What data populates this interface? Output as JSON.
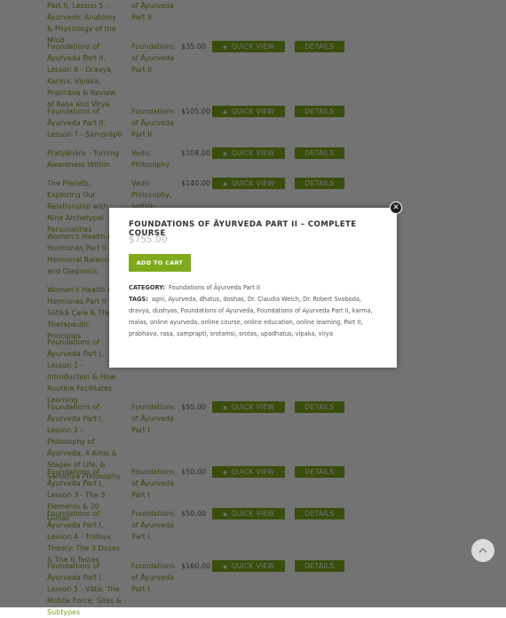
{
  "buttons": {
    "quick_view": "QUICK VIEW",
    "details": "DETAILS"
  },
  "rows": [
    {
      "title": "Part II, Lesson 5 - Āyurvedic Anatomy & Physiology of the Mind",
      "category": "of Āyurveda Part II",
      "price": "",
      "buttons": false
    },
    {
      "title": "Foundations of Āyurveda Part II, Lesson 6 - Dravya, Karma, Vipāka, Prabhāva & Review of Rasa and Vīrya",
      "category": "Foundations of Āyurveda Part II",
      "price": "$35.00",
      "buttons": true
    },
    {
      "title": "Foundations of Āyurveda Part II, Lesson 7 - Samprāpti",
      "category": "Foundations of Āyurveda Part II",
      "price": "$105.00",
      "buttons": true
    },
    {
      "title": "Pratyāhāra - Turning Awareness Within",
      "category": "Vedic Philosophy",
      "price": "$108.00",
      "buttons": true
    },
    {
      "title": "The Planets: Exploring Our Relationship with Nine Archetypal Personalities",
      "category": "Vedic Philosophy, Jyotish",
      "price": "$140.00",
      "buttons": true
    },
    {
      "title": "Women's Health & Hormones Part II - Hormonal Balance and Diagnosis",
      "category": "",
      "price": "",
      "buttons": false
    },
    {
      "title": "Women's Health & Hormones Part II - Sūtikā Care & The 3 Therapeutic Principles",
      "category": "",
      "price": "",
      "buttons": false
    },
    {
      "title": "Foundations of Āyurveda Part I, Lesson 1 - Introduction & How Routine Facilitates Learning",
      "category": "",
      "price": "",
      "buttons": false
    },
    {
      "title": "Foundations of Āyurveda Part I, Lesson 2 - Philosophy of Āyurveda, 4 Aims & Stages of Life, & Sāṁkhya Philosophy",
      "category": "Foundations of Āyurveda Part I",
      "price": "$95.00",
      "buttons": true
    },
    {
      "title": "Foundations of Āyurveda Part I, Lesson 3 - The 5 Elements & 20 Guṇas",
      "category": "Foundations of Āyurveda Part I",
      "price": "$50.00",
      "buttons": true
    },
    {
      "title": "Foundations of Āyurveda Part I, Lesson 4 - Tridoṣa Theory: The 3 Doṣas & The 6 Tastes",
      "category": "Foundations of Āyurveda Part I",
      "price": "$50.00",
      "buttons": true
    },
    {
      "title": "Foundations of Āyurveda Part I, Lesson 5 - Vāta: The Mobile Force; Sites & Subtypes",
      "category": "Foundations of Āyurveda Part I",
      "price": "$160.00",
      "buttons": true
    }
  ],
  "modal": {
    "title": "FOUNDATIONS OF ĀYURVEDA PART II – COMPLETE COURSE",
    "price": "$755.00",
    "add_to_cart": "ADD TO CART",
    "category_label": "CATEGORY:",
    "category_value": "Foundations of Āyurveda Part II",
    "tags_label": "TAGS:",
    "tags": [
      "agni",
      "Ayurveda",
      "dhatus",
      "doshas",
      "Dr. Claudia Welch",
      "Dr. Robert Svoboda",
      "dravya",
      "dushyas",
      "Foundations of Ayurveda",
      "Foundations of Ayurveda Part II",
      "karma",
      "malas",
      "online ayurveda",
      "online course",
      "online education",
      "online learning",
      "Part II",
      "prabhava",
      "rasa",
      "samprapti",
      "srotamsi",
      "srotas",
      "upadhatus",
      "vipaka",
      "virya"
    ],
    "close_icon": "close-icon"
  },
  "scroll_top_icon": "chevron-up-icon"
}
